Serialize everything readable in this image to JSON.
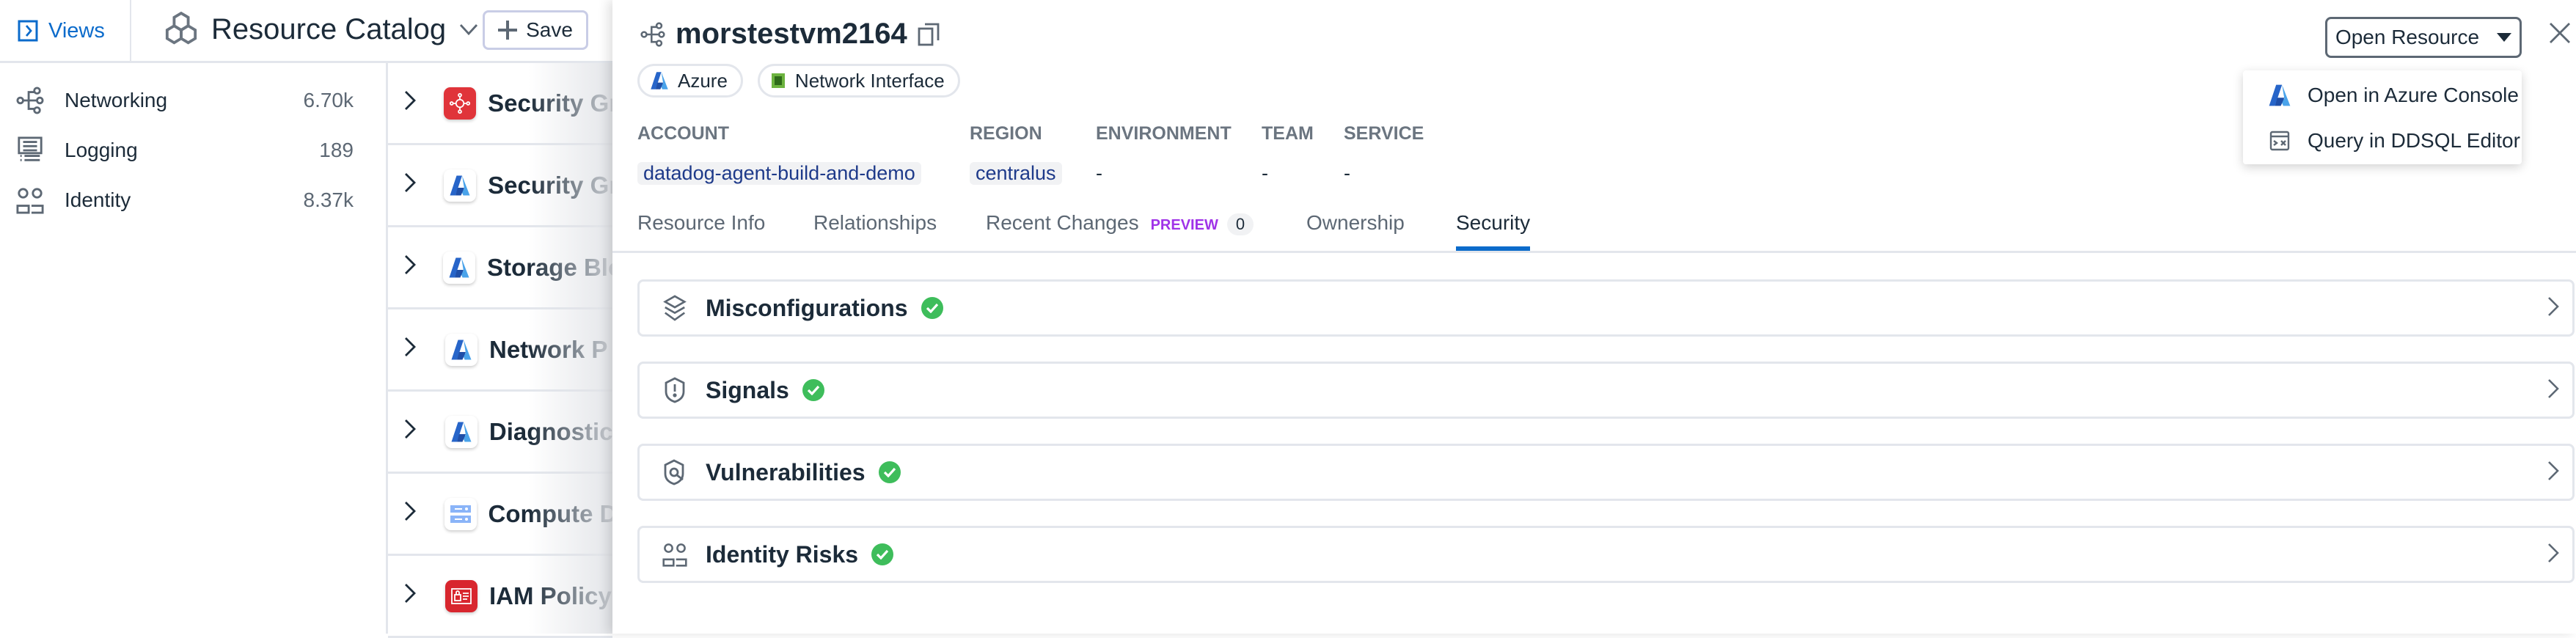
{
  "topbar": {
    "views_label": "Views",
    "title": "Resource Catalog",
    "save_label": "Save"
  },
  "sidebar": {
    "items": [
      {
        "label": "Networking",
        "count": "6.70k",
        "icon": "networking-icon"
      },
      {
        "label": "Logging",
        "count": "189",
        "icon": "logging-icon"
      },
      {
        "label": "Identity",
        "count": "8.37k",
        "icon": "identity-icon"
      }
    ]
  },
  "list": {
    "rows": [
      {
        "name": "Security Gr",
        "icon": "aws-security-group-icon"
      },
      {
        "name": "Security Gr",
        "icon": "azure-icon"
      },
      {
        "name": "Storage Blo",
        "icon": "azure-icon"
      },
      {
        "name": "Network P",
        "icon": "azure-icon"
      },
      {
        "name": "Diagnostic",
        "icon": "azure-icon"
      },
      {
        "name": "Compute D",
        "icon": "gcp-compute-icon"
      },
      {
        "name": "IAM Policy",
        "icon": "aws-iam-icon"
      }
    ]
  },
  "panel": {
    "title": "morstestvm2164",
    "chips": [
      "Azure",
      "Network Interface"
    ],
    "fields": [
      {
        "label": "ACCOUNT",
        "value": "datadog-agent-build-and-demo"
      },
      {
        "label": "REGION",
        "value": "centralus"
      },
      {
        "label": "ENVIRONMENT",
        "value": "-"
      },
      {
        "label": "TEAM",
        "value": "-"
      },
      {
        "label": "SERVICE",
        "value": "-"
      }
    ],
    "tabs": [
      {
        "label": "Resource Info"
      },
      {
        "label": "Relationships"
      },
      {
        "label": "Recent Changes",
        "tag": "PREVIEW",
        "badge": "0"
      },
      {
        "label": "Ownership"
      },
      {
        "label": "Security",
        "active": true
      }
    ],
    "sections": [
      {
        "title": "Misconfigurations",
        "status": "ok"
      },
      {
        "title": "Signals",
        "status": "ok"
      },
      {
        "title": "Vulnerabilities",
        "status": "ok"
      },
      {
        "title": "Identity Risks",
        "status": "ok"
      }
    ],
    "open_resource_label": "Open Resource",
    "menu": [
      {
        "label": "Open in Azure Console"
      },
      {
        "label": "Query in DDSQL Editor"
      }
    ]
  },
  "colors": {
    "accent": "#0b6bcb",
    "success": "#3ebd5b",
    "preview": "#a033e8"
  }
}
